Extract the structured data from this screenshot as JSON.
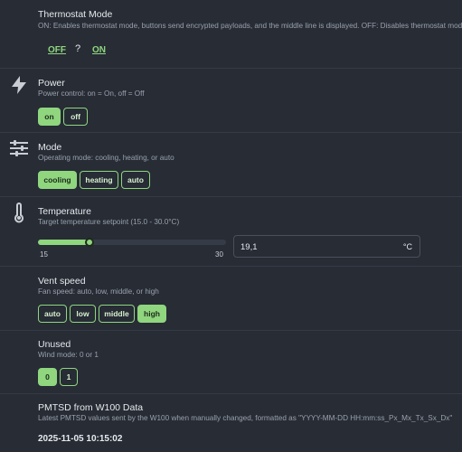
{
  "thermostat_mode": {
    "title": "Thermostat Mode",
    "description": "ON: Enables thermostat mode, buttons send encrypted payloads, and the middle line is displayed. OFF: Disables thermostat mode, b",
    "off_link": "OFF",
    "state": "?",
    "on_link": "ON"
  },
  "power": {
    "icon": "lightning-icon",
    "title": "Power",
    "description": "Power control: on = On, off = Off",
    "options": [
      "on",
      "off"
    ],
    "selected": "on"
  },
  "mode": {
    "icon": "sliders-icon",
    "title": "Mode",
    "description": "Operating mode: cooling, heating, or auto",
    "options": [
      "cooling",
      "heating",
      "auto"
    ],
    "selected": "cooling"
  },
  "temperature": {
    "icon": "thermometer-icon",
    "title": "Temperature",
    "description": "Target temperature setpoint (15.0 - 30.0°C)",
    "min_label": "15",
    "max_label": "30",
    "min": 15,
    "max": 30,
    "value": 19.1,
    "value_text": "19,1",
    "unit": "°C"
  },
  "vent_speed": {
    "title": "Vent speed",
    "description": "Fan speed: auto, low, middle, or high",
    "options": [
      "auto",
      "low",
      "middle",
      "high"
    ],
    "selected": "high"
  },
  "unused": {
    "title": "Unused",
    "description": "Wind mode: 0 or 1",
    "options": [
      "0",
      "1"
    ],
    "selected": "0"
  },
  "pmtsd": {
    "title": "PMTSD from W100 Data",
    "description": "Latest PMTSD values sent by the W100 when manually changed, formatted as \"YYYY-MM-DD HH:mm:ss_Px_Mx_Tx_Sx_Dx\"",
    "timestamp": "2025-11-05 10:15:02"
  },
  "colors": {
    "background": "#272c35",
    "accent": "#8fd67e",
    "text": "#e6e9ed",
    "muted": "#9aa1ab"
  }
}
